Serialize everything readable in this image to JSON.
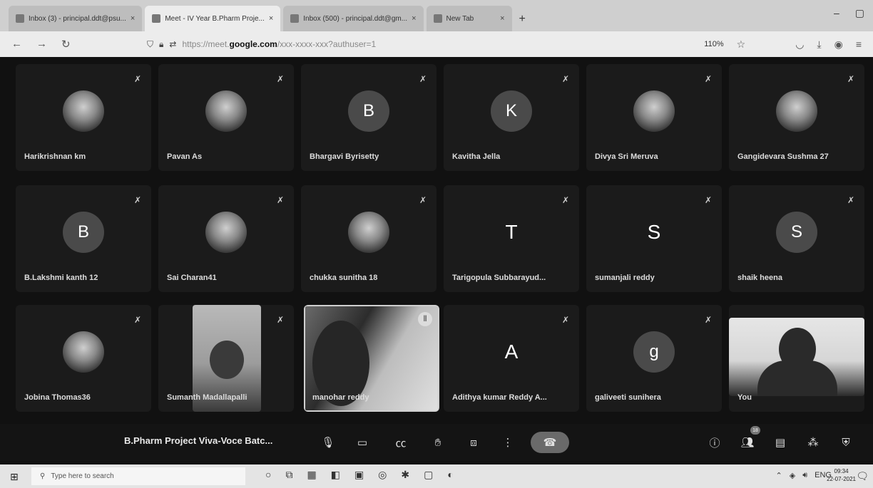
{
  "browser": {
    "tabs": [
      {
        "label": "Inbox (3) - principal.ddt@psu...",
        "active": false
      },
      {
        "label": "Meet - IV Year B.Pharm Proje...",
        "active": true
      },
      {
        "label": "Inbox (500) - principal.ddt@gm...",
        "active": false
      },
      {
        "label": "New Tab",
        "active": false
      }
    ],
    "tab_close_glyph": "×",
    "new_tab_glyph": "+",
    "url_domain": "google.com",
    "url_prefix": "https://meet.",
    "url_path": "/xxx-xxxx-xxx?authuser=1",
    "zoom": "110%"
  },
  "participants": [
    {
      "name": "Harikrishnan km",
      "avatar": "photo",
      "initial": ""
    },
    {
      "name": "Pavan As",
      "avatar": "photo",
      "initial": ""
    },
    {
      "name": "Bhargavi Byrisetty",
      "avatar": "letter",
      "initial": "B"
    },
    {
      "name": "Kavitha Jella",
      "avatar": "letter",
      "initial": "K"
    },
    {
      "name": "Divya Sri Meruva",
      "avatar": "photo",
      "initial": ""
    },
    {
      "name": "Gangidevara Sushma 27",
      "avatar": "photo",
      "initial": ""
    },
    {
      "name": "B.Lakshmi kanth 12",
      "avatar": "letter",
      "initial": "B"
    },
    {
      "name": "Sai Charan41",
      "avatar": "photo",
      "initial": ""
    },
    {
      "name": "chukka sunitha 18",
      "avatar": "photo",
      "initial": ""
    },
    {
      "name": "Tarigopula Subbarayud...",
      "avatar": "plain",
      "initial": "T"
    },
    {
      "name": "sumanjali reddy",
      "avatar": "plain",
      "initial": "S"
    },
    {
      "name": "shaik heena",
      "avatar": "letter",
      "initial": "S"
    },
    {
      "name": "Jobina Thomas36",
      "avatar": "photo",
      "initial": ""
    },
    {
      "name": "Sumanth Madallapalli",
      "avatar": "video",
      "initial": ""
    },
    {
      "name": "manohar reddy",
      "avatar": "video",
      "initial": ""
    },
    {
      "name": "Adithya kumar Reddy A...",
      "avatar": "plain",
      "initial": "A"
    },
    {
      "name": "galiveeti sunihera",
      "avatar": "letter",
      "initial": "g"
    },
    {
      "name": "You",
      "avatar": "video",
      "initial": ""
    }
  ],
  "meeting": {
    "title": "B.Pharm Project Viva-Voce Batc...",
    "people_count": "18"
  },
  "taskbar": {
    "search_placeholder": "Type here to search",
    "language": "ENG",
    "time": "09:34",
    "date": "22-07-2021"
  },
  "colors": {
    "background": "#111111",
    "tile": "#1b1b1b",
    "end_call": "#6a6a6a",
    "taskbar": "#e4e4e4"
  }
}
